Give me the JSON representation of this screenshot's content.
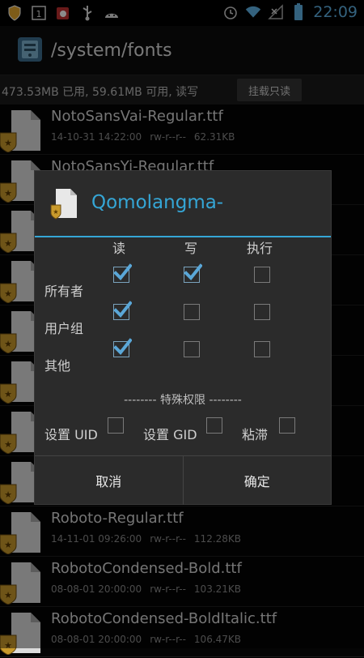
{
  "status_bar": {
    "time": "22:09",
    "left_icons": [
      "shield-notification-icon",
      "calendar-icon",
      "app-notification-icon",
      "usb-icon",
      "android-debug-icon"
    ],
    "right_icons": [
      "alarm-icon",
      "wifi-icon",
      "no-signal-icon",
      "battery-icon"
    ]
  },
  "titlebar": {
    "path": "/system/fonts"
  },
  "storage": {
    "summary": "473.53MB 已用, 59.61MB 可用, 读写",
    "mount_button": "挂载只读"
  },
  "files": [
    {
      "name": "NotoSansVai-Regular.ttf",
      "date": "14-10-31 14:22:00",
      "perms": "rw-r--r--",
      "size": "62.31KB"
    },
    {
      "name": "NotoSansYi-Regular.ttf",
      "date": "",
      "perms": "",
      "size": ""
    },
    {
      "name": "",
      "date": "",
      "perms": "",
      "size": ""
    },
    {
      "name": "",
      "date": "",
      "perms": "",
      "size": ""
    },
    {
      "name": "",
      "date": "",
      "perms": "",
      "size": ""
    },
    {
      "name": "",
      "date": "",
      "perms": "",
      "size": ""
    },
    {
      "name": "",
      "date": "",
      "perms": "",
      "size": ""
    },
    {
      "name": "",
      "date": "",
      "perms": "",
      "size": ""
    },
    {
      "name": "Roboto-Regular.ttf",
      "date": "14-11-01 09:26:00",
      "perms": "rw-r--r--",
      "size": "112.28KB"
    },
    {
      "name": "RobotoCondensed-Bold.ttf",
      "date": "08-08-01 20:00:00",
      "perms": "rw-r--r--",
      "size": "103.21KB"
    },
    {
      "name": "RobotoCondensed-BoldItalic.ttf",
      "date": "08-08-01 20:00:00",
      "perms": "rw-r--r--",
      "size": "106.47KB"
    }
  ],
  "dialog": {
    "title": "Qomolangma-",
    "columns": {
      "read": "读",
      "write": "写",
      "execute": "执行"
    },
    "rows": [
      {
        "label": "所有者",
        "read": true,
        "write": true,
        "execute": false
      },
      {
        "label": "用户组",
        "read": true,
        "write": false,
        "execute": false
      },
      {
        "label": "其他",
        "read": true,
        "write": false,
        "execute": false
      }
    ],
    "special_header": "-------- 特殊权限 --------",
    "special": {
      "set_uid": {
        "label": "设置 UID",
        "checked": false
      },
      "set_gid": {
        "label": "设置 GID",
        "checked": false
      },
      "sticky": {
        "label": "粘滞",
        "checked": false
      }
    },
    "cancel_label": "取消",
    "ok_label": "确定"
  },
  "colors": {
    "accent": "#35a6d6",
    "check": "#5aa7d8",
    "time": "#5fb3e6"
  }
}
